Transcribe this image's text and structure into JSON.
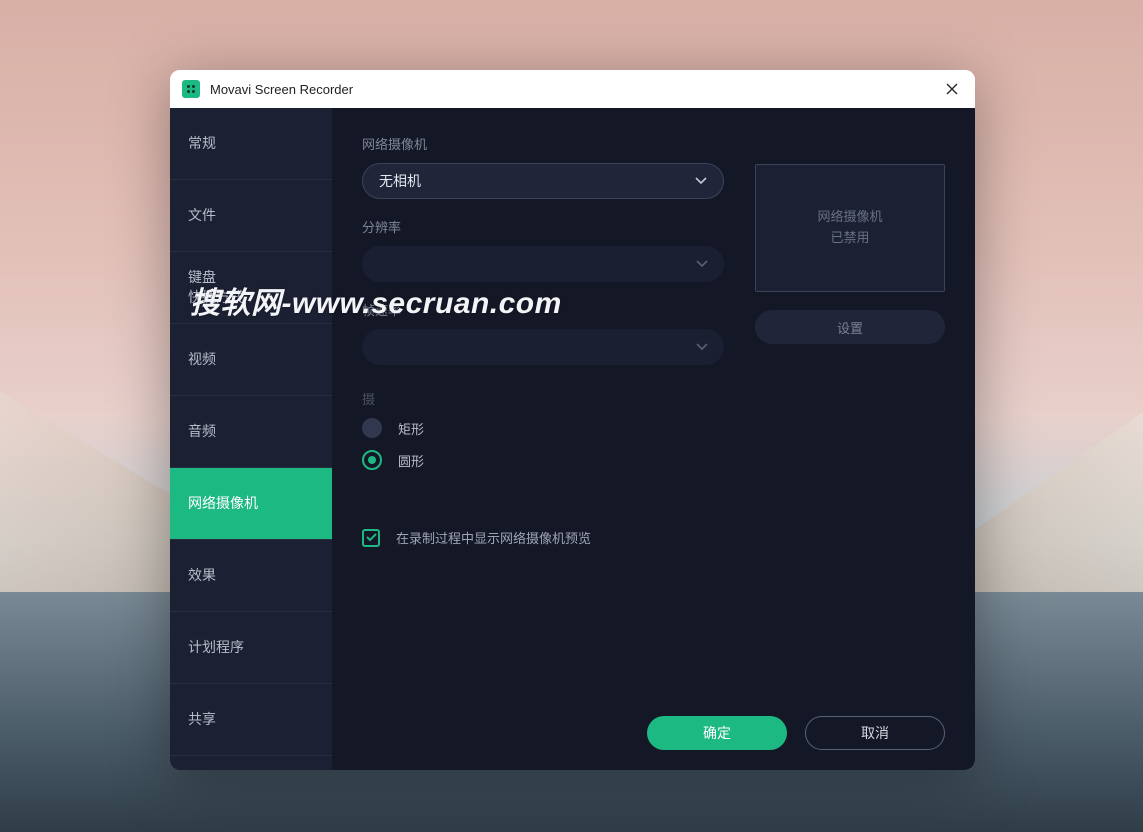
{
  "titlebar": {
    "title": "Movavi Screen Recorder"
  },
  "sidebar": {
    "items": [
      {
        "label": "常规"
      },
      {
        "label": "文件"
      },
      {
        "label": "键盘\n快捷方式"
      },
      {
        "label": "视频"
      },
      {
        "label": "音频"
      },
      {
        "label": "网络摄像机"
      },
      {
        "label": "效果"
      },
      {
        "label": "计划程序"
      },
      {
        "label": "共享"
      }
    ],
    "active_index": 5
  },
  "content": {
    "webcam_label": "网络摄像机",
    "webcam_value": "无相机",
    "resolution_label": "分辨率",
    "resolution_value": "",
    "framerate_label": "帧速率",
    "framerate_value": "",
    "shape_label": "摄",
    "shape_rectangle": "矩形",
    "shape_circle": "圆形",
    "shape_selected": "circle",
    "show_preview_checkbox": "在录制过程中显示网络摄像机预览",
    "show_preview_checked": true
  },
  "preview": {
    "line1": "网络摄像机",
    "line2": "已禁用",
    "settings_button": "设置"
  },
  "footer": {
    "ok": "确定",
    "cancel": "取消"
  },
  "watermark": "搜软网-www.secruan.com"
}
